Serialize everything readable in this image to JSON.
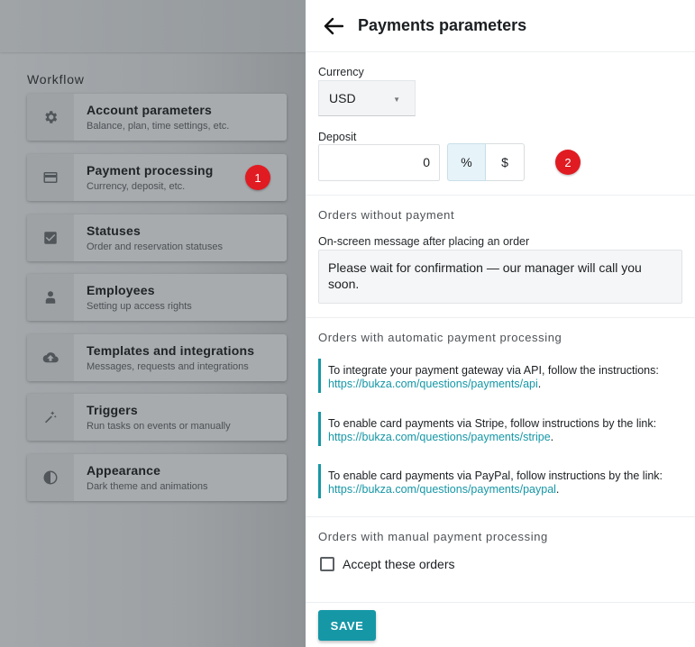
{
  "sidebar": {
    "title": "Workflow",
    "items": [
      {
        "title": "Account parameters",
        "subtitle": "Balance, plan, time settings, etc.",
        "icon": "gear-icon"
      },
      {
        "title": "Payment processing",
        "subtitle": "Currency, deposit, etc.",
        "icon": "credit-card-icon"
      },
      {
        "title": "Statuses",
        "subtitle": "Order and reservation statuses",
        "icon": "checkbox-icon"
      },
      {
        "title": "Employees",
        "subtitle": "Setting up access rights",
        "icon": "person-icon"
      },
      {
        "title": "Templates and integrations",
        "subtitle": "Messages, requests and integrations",
        "icon": "cloud-upload-icon"
      },
      {
        "title": "Triggers",
        "subtitle": "Run tasks on events or manually",
        "icon": "magic-wand-icon"
      },
      {
        "title": "Appearance",
        "subtitle": "Dark theme and animations",
        "icon": "contrast-icon"
      }
    ]
  },
  "badges": {
    "one": "1",
    "two": "2"
  },
  "panel": {
    "title": "Payments parameters",
    "currency": {
      "label": "Currency",
      "value": "USD"
    },
    "deposit": {
      "label": "Deposit",
      "value": "0",
      "unit_percent": "%",
      "unit_dollar": "$",
      "selected": "%"
    },
    "orders_without_payment": {
      "heading": "Orders without payment",
      "message_label": "On-screen message after placing an order",
      "message": "Please wait for confirmation — our manager will call you soon."
    },
    "automatic": {
      "heading": "Orders with automatic payment processing",
      "notes": [
        {
          "text": "To integrate your payment gateway via API, follow the instructions:",
          "link": "https://bukza.com/questions/payments/api",
          "suffix": "."
        },
        {
          "text": "To enable card payments via Stripe, follow instructions by the link:",
          "link": "https://bukza.com/questions/payments/stripe",
          "suffix": "."
        },
        {
          "text": "To enable card payments via PayPal, follow instructions by the link:",
          "link": "https://bukza.com/questions/payments/paypal",
          "suffix": "."
        }
      ]
    },
    "manual": {
      "heading": "Orders with manual payment processing",
      "accept_label": "Accept these orders",
      "accept_checked": false
    },
    "save_label": "SAVE"
  },
  "colors": {
    "accent": "#1597a6",
    "badge": "#e11b22"
  }
}
